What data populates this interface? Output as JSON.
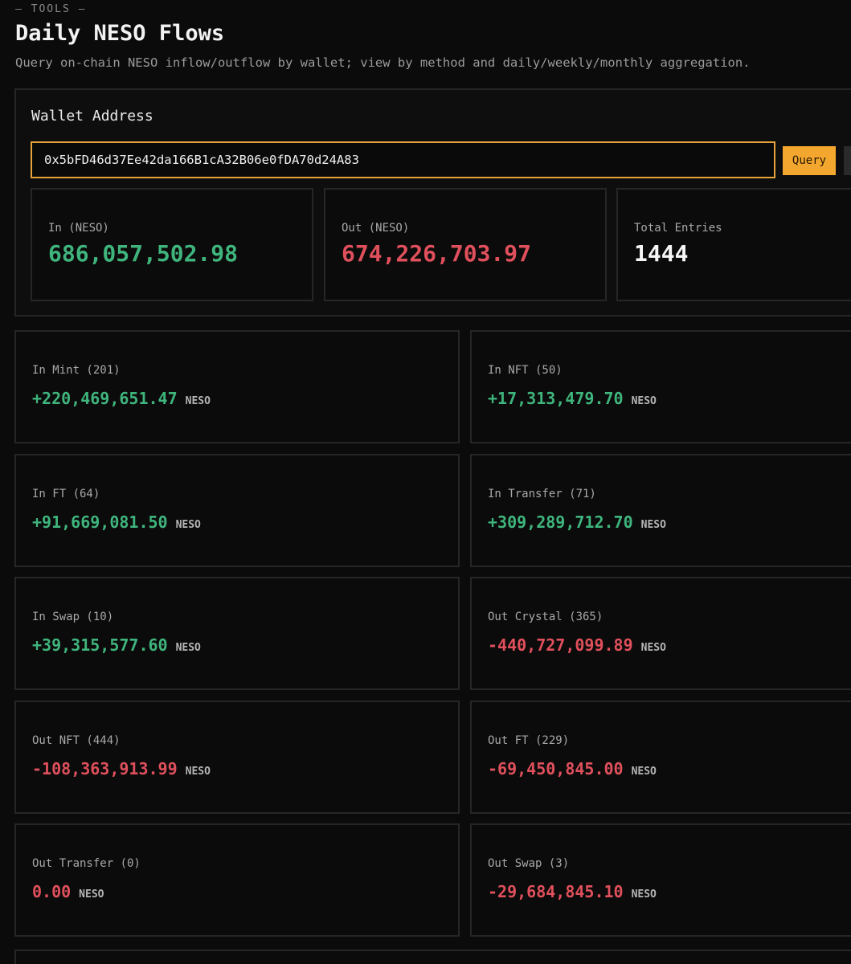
{
  "header": {
    "eyebrow": "— TOOLS —",
    "title": "Daily NESO Flows",
    "subtitle": "Query on-chain NESO inflow/outflow by wallet; view by method and daily/weekly/monthly aggregation."
  },
  "wallet": {
    "label": "Wallet Address",
    "address": "0x5bFD46d37Ee42da166B1cA32B06e0fDA70d24A83",
    "query_label": "Query"
  },
  "summary": [
    {
      "label": "In (NESO)",
      "value": "686,057,502.98",
      "tone": "green"
    },
    {
      "label": "Out (NESO)",
      "value": "674,226,703.97",
      "tone": "red"
    },
    {
      "label": "Total Entries",
      "value": "1444",
      "tone": "white"
    }
  ],
  "unit": "NESO",
  "methods": [
    {
      "label": "In Mint (201)",
      "amount": "+220,469,651.47",
      "tone": "green"
    },
    {
      "label": "In NFT (50)",
      "amount": "+17,313,479.70",
      "tone": "green"
    },
    {
      "label": "In FT (64)",
      "amount": "+91,669,081.50",
      "tone": "green"
    },
    {
      "label": "In Transfer (71)",
      "amount": "+309,289,712.70",
      "tone": "green"
    },
    {
      "label": "In Swap (10)",
      "amount": "+39,315,577.60",
      "tone": "green"
    },
    {
      "label": "Out Crystal (365)",
      "amount": "-440,727,099.89",
      "tone": "red"
    },
    {
      "label": "Out NFT (444)",
      "amount": "-108,363,913.99",
      "tone": "red"
    },
    {
      "label": "Out FT (229)",
      "amount": "-69,450,845.00",
      "tone": "red"
    },
    {
      "label": "Out Transfer (0)",
      "amount": "0.00",
      "tone": "red"
    },
    {
      "label": "Out Swap (3)",
      "amount": "-29,684,845.10",
      "tone": "red"
    }
  ],
  "colors": {
    "accent": "#f3a72f",
    "positive": "#3fb57d",
    "negative": "#e0505c",
    "background": "#0b0b0b"
  }
}
